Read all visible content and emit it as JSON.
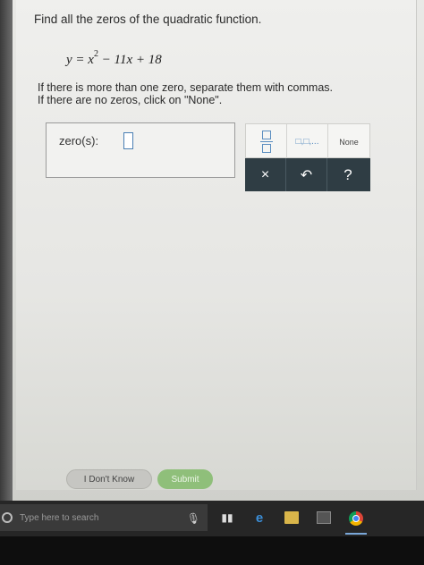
{
  "question": {
    "prompt": "Find all the zeros of the quadratic function.",
    "equation_lhs": "y = x",
    "equation_exp": "2",
    "equation_rhs": " − 11x + 18",
    "instruction_line1": "If there is more than one zero, separate them with commas.",
    "instruction_line2": "If there are no zeros, click on \"None\"."
  },
  "answer": {
    "label": "zero(s):",
    "value": ""
  },
  "keypad": {
    "list_key": "□,□,...",
    "none_key": "None",
    "clear_key": "×",
    "undo_key": "↶",
    "help_key": "?"
  },
  "actions": {
    "dont_know": "I Don't Know",
    "submit": "Submit"
  },
  "taskbar": {
    "search_placeholder": "Type here to search"
  },
  "colors": {
    "keypad_dark": "#2f3d44",
    "submit_green": "#8fbf7a",
    "input_blue": "#4a7fb3"
  }
}
